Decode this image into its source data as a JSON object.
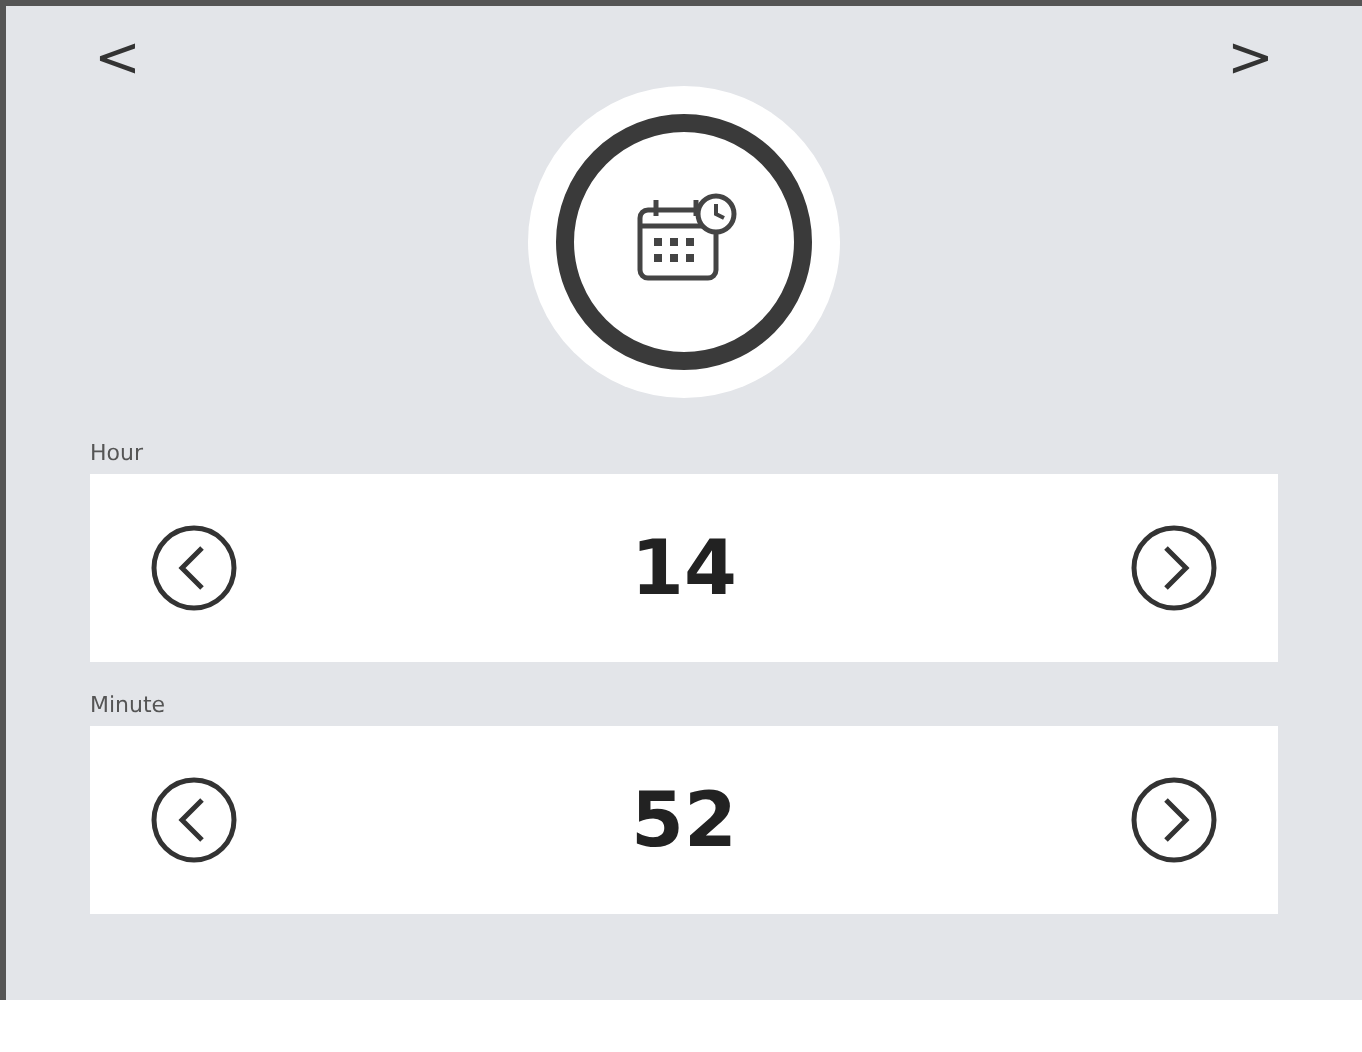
{
  "nav": {
    "prev": "<",
    "next": ">"
  },
  "fields": [
    {
      "label": "Hour",
      "value": "14"
    },
    {
      "label": "Minute",
      "value": "52"
    }
  ]
}
